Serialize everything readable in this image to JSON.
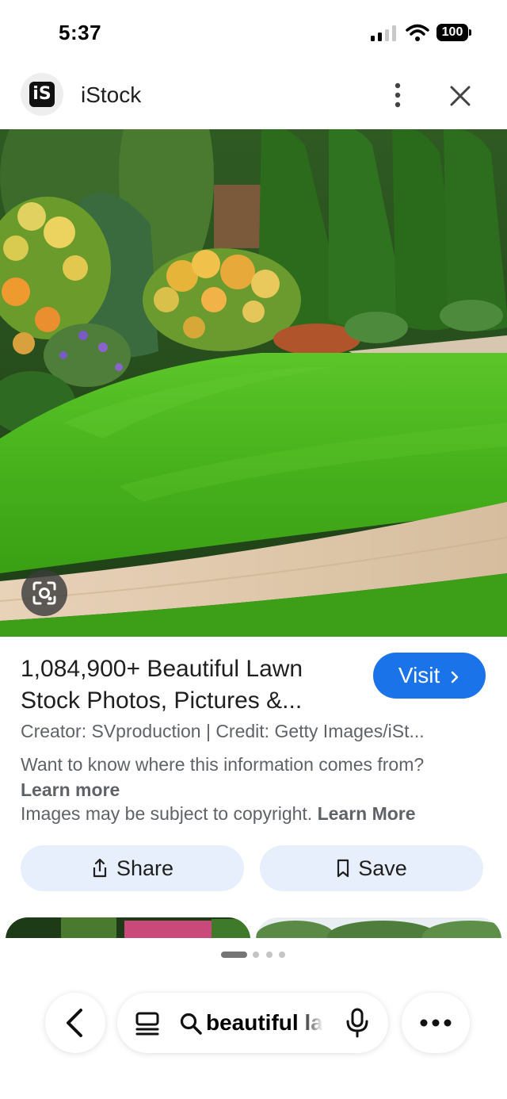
{
  "status_bar": {
    "time": "5:37",
    "battery": "100"
  },
  "site": {
    "name": "iStock",
    "logo_text": "iS"
  },
  "result": {
    "title_line1": "1,084,900+ Beautiful Lawn",
    "title_line2": "Stock Photos, Pictures &...",
    "visit_label": "Visit",
    "creator_text": "Creator: SVproduction | Credit: Getty Images/iSt...",
    "info_text": "Want to know where this information comes from?",
    "learn_more": "Learn more",
    "copyright_text": "Images may be subject to copyright.",
    "copyright_link": "Learn More"
  },
  "actions": {
    "share_label": "Share",
    "save_label": "Save"
  },
  "bottom_nav": {
    "search_query": "beautiful la"
  },
  "icons": [
    "signal-icon",
    "wifi-icon",
    "battery-icon",
    "more-vert-icon",
    "close-icon",
    "lens-icon",
    "share-icon",
    "bookmark-icon",
    "back-icon",
    "tabs-icon",
    "search-icon",
    "mic-icon",
    "more-horiz-icon"
  ],
  "colors": {
    "accent": "#1a73e8",
    "action_bg": "#e8effc",
    "secondary_text": "#5f6368"
  }
}
